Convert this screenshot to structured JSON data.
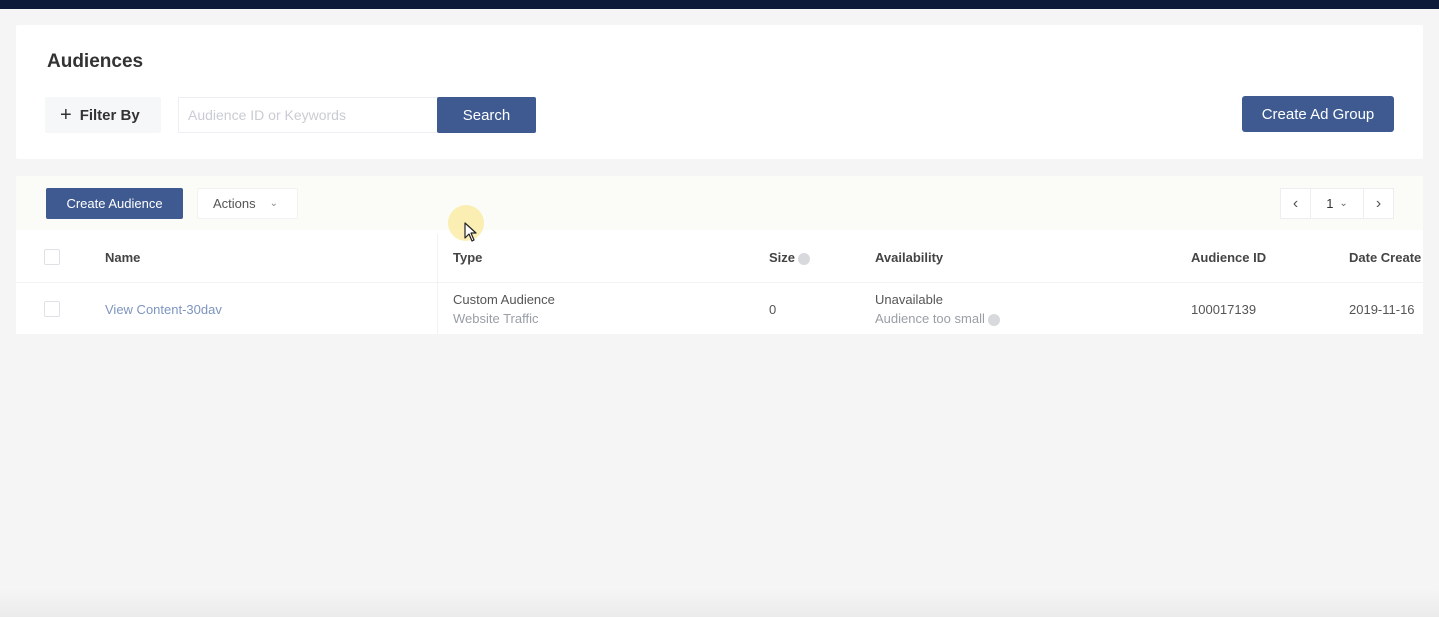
{
  "page": {
    "title": "Audiences"
  },
  "filter": {
    "label": "Filter By",
    "icon": "plus-icon"
  },
  "search": {
    "placeholder": "Audience ID or Keywords",
    "value": "",
    "button_label": "Search"
  },
  "header_actions": {
    "create_ad_group_label": "Create Ad Group"
  },
  "toolbar": {
    "create_audience_label": "Create Audience",
    "actions_label": "Actions"
  },
  "pagination": {
    "current_page": "1"
  },
  "table": {
    "columns": [
      "Name",
      "Type",
      "Size",
      "Availability",
      "Audience ID",
      "Date Create"
    ],
    "rows": [
      {
        "name": "View Content-30dav",
        "type": "Custom Audience",
        "subtype": "Website Traffic",
        "size": "0",
        "availability": "Unavailable",
        "availability_reason": "Audience too small",
        "audience_id": "100017139",
        "date_created": "2019-11-16"
      }
    ]
  },
  "colors": {
    "primary": "#3e5a91",
    "topbar": "#0e1a3a",
    "link": "#7d95bf"
  }
}
